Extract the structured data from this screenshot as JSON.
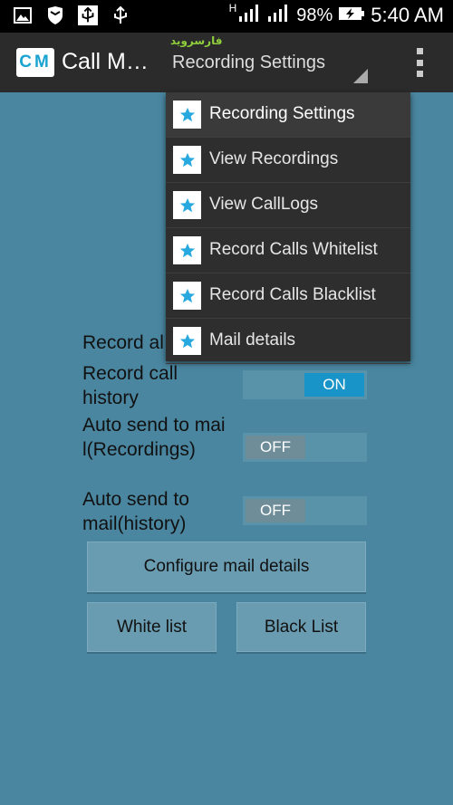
{
  "status_bar": {
    "icons": [
      "image-icon",
      "shield-icon",
      "usb-debug-icon",
      "usb-icon"
    ],
    "network_label": "H",
    "battery_percent": "98%",
    "time": "5:40 AM"
  },
  "action_bar": {
    "logo_text": "CM",
    "title": "Call M…",
    "watermark": "فارسروید",
    "spinner_value": "Recording Settings"
  },
  "dropdown": {
    "items": [
      {
        "label": "Recording Settings",
        "icon": "star-icon",
        "selected": true
      },
      {
        "label": "View Recordings",
        "icon": "star-icon",
        "selected": false
      },
      {
        "label": "View CallLogs",
        "icon": "star-icon",
        "selected": false
      },
      {
        "label": "Record Calls Whitelist",
        "icon": "star-icon",
        "selected": false
      },
      {
        "label": "Record Calls Blacklist",
        "icon": "star-icon",
        "selected": false
      },
      {
        "label": "Mail details",
        "icon": "star-icon",
        "selected": false
      }
    ]
  },
  "settings": {
    "record_all_label": "Record al",
    "record_history_label": "Record call history",
    "record_history_state": "ON",
    "auto_send_recordings_label": "Auto send to mail(Recordings)",
    "auto_send_recordings_state": "OFF",
    "auto_send_history_label": "Auto send to mail(history)",
    "auto_send_history_state": "OFF"
  },
  "buttons": {
    "configure_mail": "Configure mail details",
    "white_list": "White list",
    "black_list": "Black List"
  },
  "colors": {
    "background": "#4a86a0",
    "action_bar": "#2b2b2b",
    "accent": "#1894c8"
  }
}
